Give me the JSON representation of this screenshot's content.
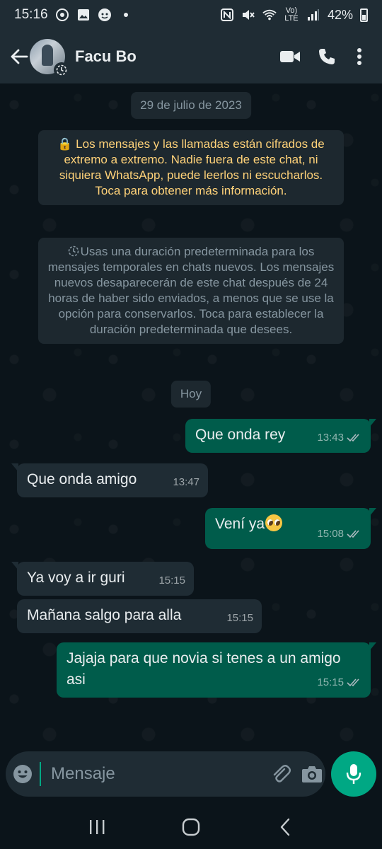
{
  "status_bar": {
    "time": "15:16",
    "network": "Vo) LTE",
    "battery": "42%",
    "icons": [
      "soccer-ball-icon",
      "gallery-icon",
      "face-icon",
      "dot-icon",
      "nfc-icon",
      "mute-icon",
      "wifi-icon",
      "signal-icon",
      "battery-icon"
    ]
  },
  "header": {
    "contact_name": "Facu Bo",
    "icons": [
      "back-arrow-icon",
      "video-call-icon",
      "phone-icon",
      "more-options-icon",
      "disappearing-timer-icon"
    ]
  },
  "chat": {
    "date_chip": "29 de julio de 2023",
    "encryption_notice": "🔒 Los mensajes y las llamadas están cifrados de extremo a extremo. Nadie fuera de este chat, ni siquiera WhatsApp, puede leerlos ni escucharlos. Toca para obtener más información.",
    "disappearing_notice": "Usas una duración predeterminada para los mensajes temporales en chats nuevos. Los mensajes nuevos desaparecerán de este chat después de 24 horas de haber sido enviados, a menos que se use la opción para conservarlos. Toca para establecer la duración predeterminada que desees.",
    "today_chip": "Hoy",
    "messages": [
      {
        "direction": "out",
        "text": "Que onda rey",
        "time": "13:43",
        "status": "read"
      },
      {
        "direction": "in",
        "text": "Que onda amigo",
        "time": "13:47"
      },
      {
        "direction": "out",
        "text": "Vení ya",
        "emoji": "pleading-face",
        "time": "15:08",
        "status": "read"
      },
      {
        "direction": "in",
        "text": "Ya voy a ir guri",
        "time": "15:15"
      },
      {
        "direction": "in",
        "text": "Mañana salgo para alla",
        "time": "15:15"
      },
      {
        "direction": "out",
        "text": "Jajaja para que novia si tenes a un amigo asi",
        "time": "15:15",
        "status": "read"
      }
    ]
  },
  "input_bar": {
    "placeholder": "Mensaje",
    "icons": [
      "emoji-icon",
      "attach-icon",
      "camera-icon",
      "mic-icon"
    ]
  },
  "nav_bar": {
    "icons": [
      "recent-apps-icon",
      "home-icon",
      "back-icon"
    ]
  },
  "colors": {
    "header_bg": "#1f2c34",
    "chat_bg": "#0b141a",
    "outgoing_bubble": "#005c4b",
    "incoming_bubble": "#1f2c34",
    "accent": "#00a884",
    "encryption_text": "#ffd279"
  }
}
